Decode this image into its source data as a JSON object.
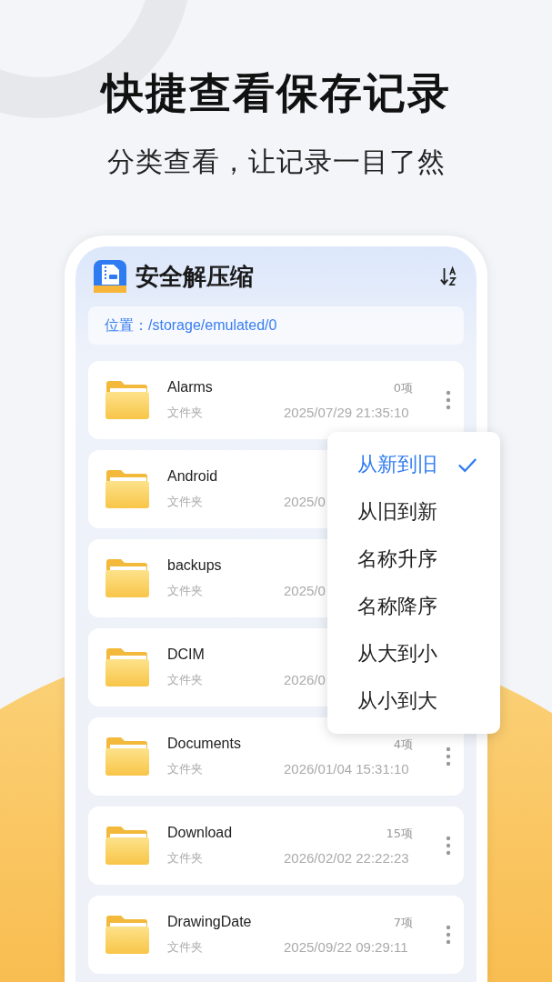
{
  "headline": "快捷查看保存记录",
  "subheadline": "分类查看，让记录一目了然",
  "app": {
    "title": "安全解压缩"
  },
  "location": {
    "label": "位置：",
    "path": "/storage/emulated/0"
  },
  "files": [
    {
      "name": "Alarms",
      "type": "文件夹",
      "count": "0项",
      "date": "2025/07/29 21:35:10"
    },
    {
      "name": "Android",
      "type": "文件夹",
      "date": "2025/0"
    },
    {
      "name": "backups",
      "type": "文件夹",
      "date": "2025/0"
    },
    {
      "name": "DCIM",
      "type": "文件夹",
      "date": "2026/0"
    },
    {
      "name": "Documents",
      "type": "文件夹",
      "count": "4项",
      "date": "2026/01/04 15:31:10"
    },
    {
      "name": "Download",
      "type": "文件夹",
      "count": "15项",
      "date": "2026/02/02 22:22:23"
    },
    {
      "name": "DrawingDate",
      "type": "文件夹",
      "count": "7项",
      "date": "2025/09/22 09:29:11"
    }
  ],
  "sort_menu": [
    {
      "label": "从新到旧",
      "selected": true
    },
    {
      "label": "从旧到新",
      "selected": false
    },
    {
      "label": "名称升序",
      "selected": false
    },
    {
      "label": "名称降序",
      "selected": false
    },
    {
      "label": "从大到小",
      "selected": false
    },
    {
      "label": "从小到大",
      "selected": false
    }
  ]
}
